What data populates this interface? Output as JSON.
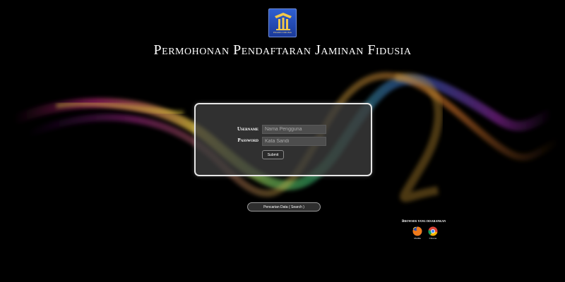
{
  "app": {
    "title": "Permohonan Pendaftaran Jaminan Fidusia",
    "logo_text": "POHON FIDUSIA"
  },
  "login": {
    "username_label": "Username",
    "username_placeholder": "Nama Pengguna",
    "password_label": "Password",
    "password_placeholder": "Kata Sandi",
    "submit_label": "Submit"
  },
  "search": {
    "label": "Pencarian Data ( Search )"
  },
  "browsers": {
    "label": "Browser yang disarankan",
    "items": [
      {
        "name": "Mozilla",
        "icon": "firefox-icon"
      },
      {
        "name": "Chrome",
        "icon": "chrome-icon"
      }
    ]
  },
  "colors": {
    "background": "#000000",
    "panel": "#3e3e3e",
    "logo_blue": "#1a3a9a"
  }
}
